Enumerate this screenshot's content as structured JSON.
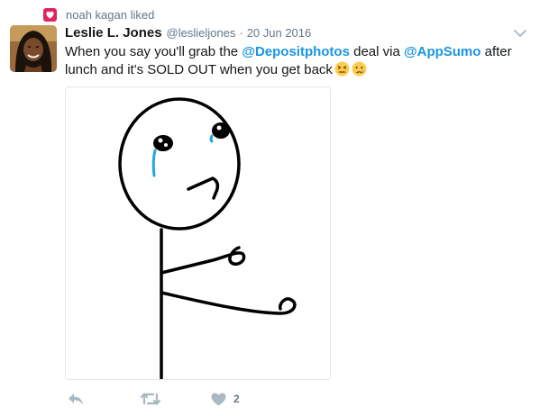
{
  "context": {
    "text": "noah kagan liked",
    "icon": "heart-badge-icon",
    "badge_color": "#e0245e"
  },
  "tweet": {
    "author_name": "Leslie L. Jones",
    "handle": "@leslieljones",
    "separator": "·",
    "date": "20 Jun 2016",
    "text_parts": {
      "t1": "When you say you'll grab the ",
      "m1": "@Depositphotos",
      "t2": " deal via ",
      "m2": "@AppSumo",
      "t3": " after lunch and it's SOLD OUT when you get back"
    },
    "emojis": [
      "persevering-face",
      "crying-face"
    ],
    "media_description_icon": "sad-stick-figure-meme",
    "actions": {
      "reply_icon": "reply-icon",
      "retweet_icon": "retweet-icon",
      "like_icon": "heart-icon",
      "like_count": "2"
    }
  },
  "colors": {
    "link": "#1b95e0",
    "muted": "#657786",
    "text": "#14171a",
    "action": "#aab8c2"
  }
}
